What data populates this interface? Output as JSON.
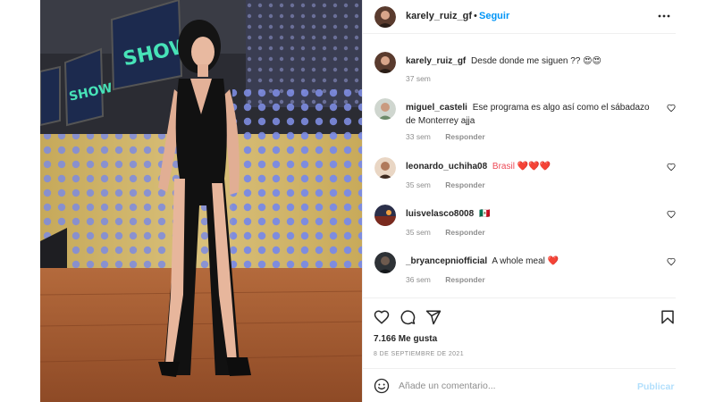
{
  "post": {
    "username": "karely_ruiz_gf",
    "separator": "•",
    "follow_label": "Seguir",
    "caption": {
      "username": "karely_ruiz_gf",
      "text": "Desde donde me siguen ?? 😍😍",
      "time": "37 sem"
    },
    "photo_sign_text": "SHOW"
  },
  "comments": [
    {
      "username": "miguel_casteli",
      "text": "Ese programa es algo así como el sábadazo de Monterrey ajja",
      "time": "33 sem",
      "reply_label": "Responder"
    },
    {
      "username": "leonardo_uchiha08",
      "text": "Brasil ❤️❤️❤️",
      "time": "35 sem",
      "reply_label": "Responder"
    },
    {
      "username": "luisvelasco8008",
      "text": "🇲🇽",
      "time": "35 sem",
      "reply_label": "Responder"
    },
    {
      "username": "_bryancepniofficial",
      "text": "A whole meal ❤️",
      "time": "36 sem",
      "reply_label": "Responder"
    }
  ],
  "stats": {
    "likes": "7.166 Me gusta",
    "date": "8 DE SEPTIEMBRE DE 2021"
  },
  "composer": {
    "placeholder": "Añade un comentario...",
    "post_label": "Publicar"
  },
  "icons": {
    "more": "more-horizontal-icon",
    "like": "heart-icon",
    "comment": "comment-bubble-icon",
    "share": "paper-plane-icon",
    "save": "bookmark-icon",
    "emoji": "smiley-icon"
  },
  "colors": {
    "accent_blue": "#0095f6",
    "disabled_blue": "#b2dffc",
    "muted_text": "#8e8e8e",
    "heart_red": "#ed4956",
    "divider": "#efefef"
  }
}
